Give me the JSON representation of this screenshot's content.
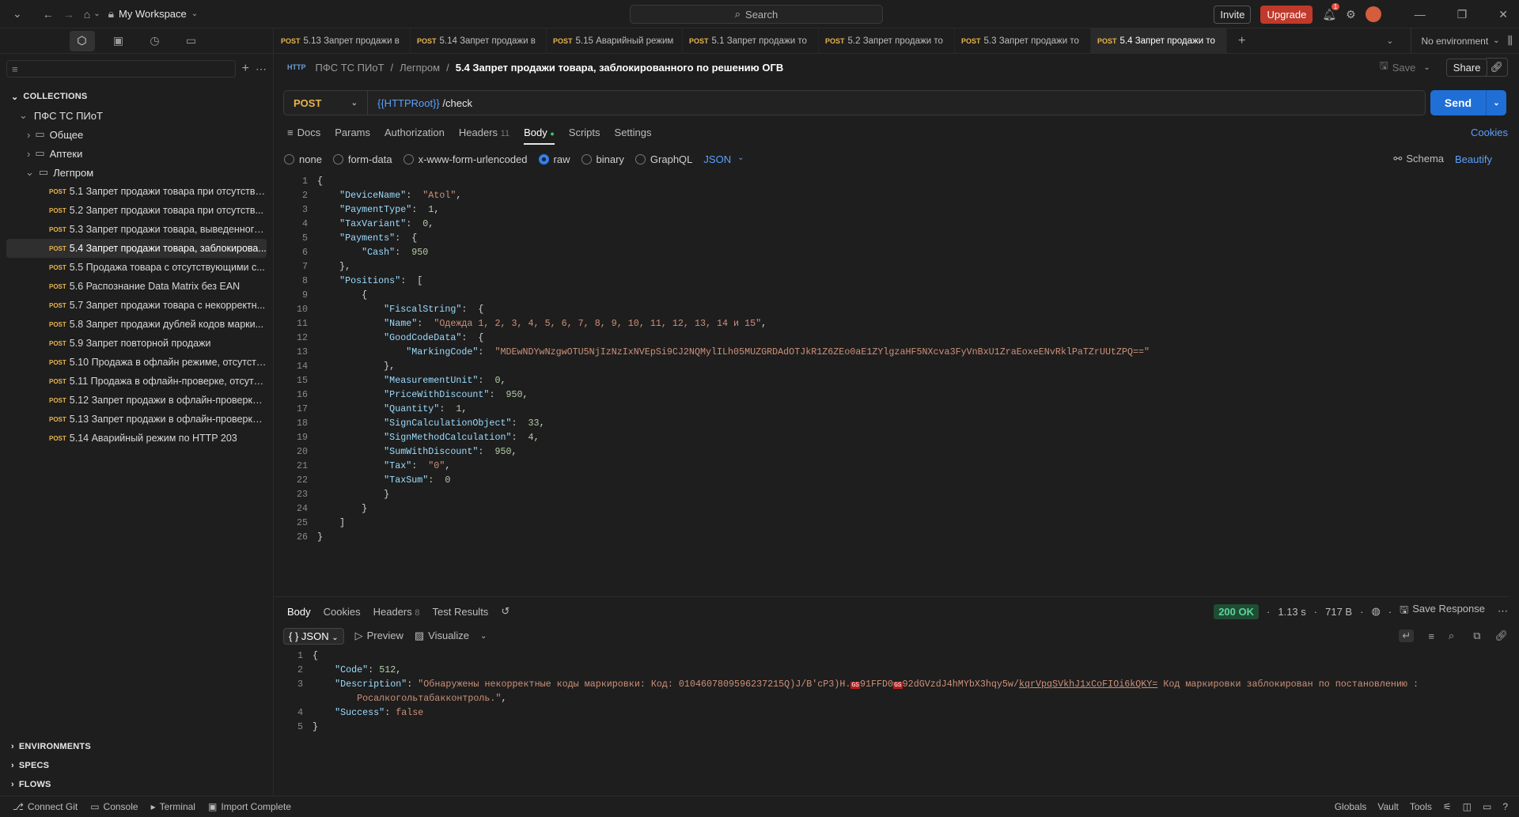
{
  "top": {
    "workspace": "My Workspace",
    "search": "Search",
    "invite": "Invite",
    "upgrade": "Upgrade",
    "notif_count": "1",
    "env": "No environment"
  },
  "sidebar": {
    "collections_label": "COLLECTIONS",
    "root": "ПФС ТС ПИоТ",
    "folders": [
      "Общее",
      "Аптеки",
      "Легпром"
    ],
    "method": "POST",
    "requests": [
      "5.1 Запрет продажи товара при отсутстви...",
      "5.2 Запрет продажи товара при отсутств...",
      "5.3 Запрет продажи товара, выведенного...",
      "5.4 Запрет продажи товара, заблокирова...",
      "5.5 Продажа товара с отсутствующими с...",
      "5.6 Распознание Data Matrix без EAN",
      "5.7 Запрет продажи товара с некорректн...",
      "5.8 Запрет продажи дублей кодов марки...",
      "5.9 Запрет повторной продажи",
      "5.10 Продажа в офлайн режиме, отсутств...",
      "5.11 Продажа в офлайн-проверке, отсутст...",
      "5.12 Запрет продажи в офлайн-проверке,...",
      "5.13 Запрет продажи в офлайн-проверке ...",
      "5.14 Аварийный режим по HTTP 203"
    ],
    "environments": "ENVIRONMENTS",
    "specs": "SPECS",
    "flows": "FLOWS"
  },
  "tabs": [
    {
      "m": "POST",
      "t": "5.13 Запрет продажи в"
    },
    {
      "m": "POST",
      "t": "5.14 Запрет продажи в"
    },
    {
      "m": "POST",
      "t": "5.15 Аварийный режим"
    },
    {
      "m": "POST",
      "t": "5.1 Запрет продажи то"
    },
    {
      "m": "POST",
      "t": "5.2 Запрет продажи то"
    },
    {
      "m": "POST",
      "t": "5.3 Запрет продажи то"
    },
    {
      "m": "POST",
      "t": "5.4 Запрет продажи то"
    }
  ],
  "crumbs": {
    "a": "ПФС ТС ПИоТ",
    "b": "Легпром",
    "c": "5.4 Запрет продажи товара, заблокированного по решению ОГВ",
    "save": "Save",
    "share": "Share"
  },
  "request": {
    "method": "POST",
    "url_var": "{{HTTPRoot}}",
    "url_path": " /check",
    "send": "Send"
  },
  "reqtabs": {
    "docs": "Docs",
    "params": "Params",
    "auth": "Authorization",
    "headers": "Headers",
    "headers_count": "11",
    "body": "Body",
    "scripts": "Scripts",
    "settings": "Settings",
    "cookies": "Cookies"
  },
  "bodyopts": {
    "none": "none",
    "formdata": "form-data",
    "urlenc": "x-www-form-urlencoded",
    "raw": "raw",
    "binary": "binary",
    "graphql": "GraphQL",
    "json": "JSON",
    "schema": "Schema",
    "beautify": "Beautify"
  },
  "response": {
    "body": "Body",
    "cookies": "Cookies",
    "headers": "Headers",
    "headers_count": "8",
    "tests": "Test Results",
    "status": "200 OK",
    "time": "1.13 s",
    "size": "717 B",
    "save": "Save Response",
    "fmt": "{ } JSON",
    "preview": "Preview",
    "visualize": "Visualize"
  },
  "status": {
    "git": "Connect Git",
    "console": "Console",
    "terminal": "Terminal",
    "import": "Import Complete",
    "globals": "Globals",
    "vault": "Vault",
    "tools": "Tools"
  }
}
